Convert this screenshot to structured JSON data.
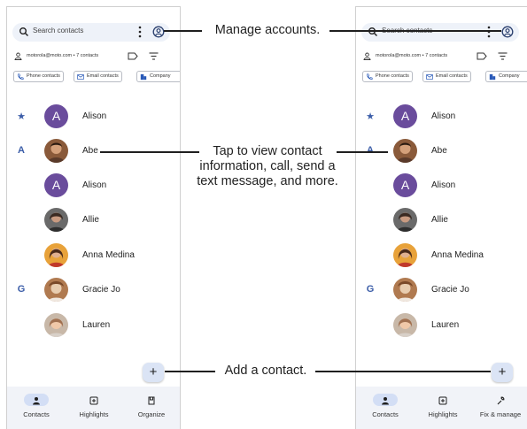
{
  "search": {
    "placeholder": "Search contacts"
  },
  "account": {
    "email": "motorola@moto.com • 7 contacts"
  },
  "chips": [
    "Phone contacts",
    "Email contacts",
    "Company"
  ],
  "contacts": [
    {
      "section": "★",
      "name": "Alison",
      "avatar_letter": "A"
    },
    {
      "section": "A",
      "name": "Abe",
      "avatar_letter": ""
    },
    {
      "section": "",
      "name": "Alison",
      "avatar_letter": "A"
    },
    {
      "section": "",
      "name": "Allie",
      "avatar_letter": ""
    },
    {
      "section": "",
      "name": "Anna Medina",
      "avatar_letter": ""
    },
    {
      "section": "G",
      "name": "Gracie Jo",
      "avatar_letter": ""
    },
    {
      "section": "",
      "name": "Lauren",
      "avatar_letter": ""
    }
  ],
  "fab": {
    "icon": "+"
  },
  "nav_left": [
    "Contacts",
    "Highlights",
    "Organize"
  ],
  "nav_right": [
    "Contacts",
    "Highlights",
    "Fix & manage"
  ],
  "callouts": {
    "manage": "Manage accounts.",
    "tap": "Tap to view contact information, call, send a text message, and more.",
    "add": "Add a contact."
  },
  "colors": {
    "accent": "#3b5da8",
    "avatar_purple": "#6a4c9c",
    "search_bg": "#eef2f9",
    "nav_bg": "#f1f3f8"
  }
}
